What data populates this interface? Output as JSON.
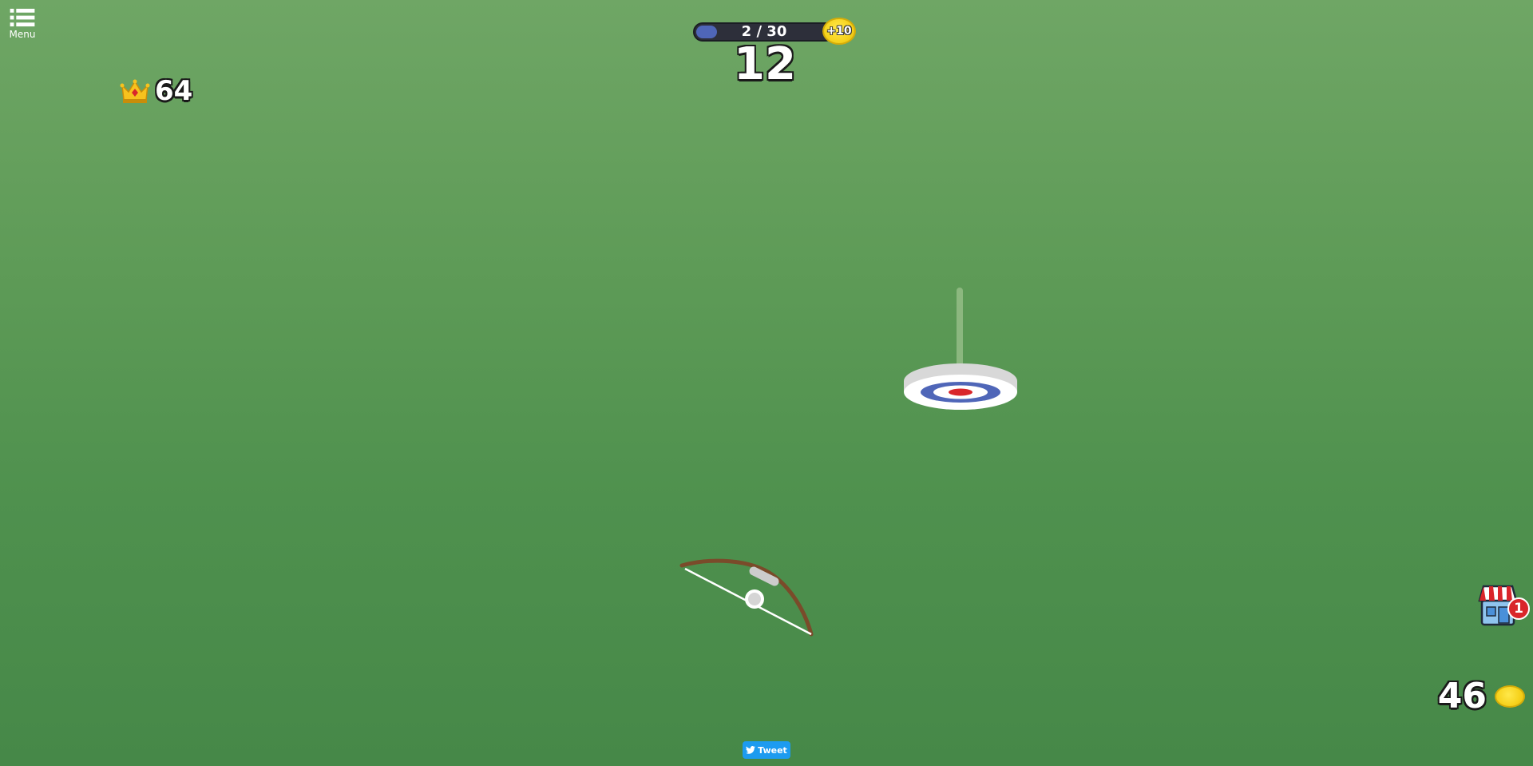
{
  "menu": {
    "label": "Menu",
    "icon": "list-icon"
  },
  "best_score": {
    "icon": "crown-icon",
    "value": "64"
  },
  "progress": {
    "text": "2 / 30",
    "fraction": 0.067,
    "reward_label": "+10",
    "fill_color": "#4f66b8"
  },
  "current_score": "12",
  "target": {
    "icon": "bullseye-target",
    "colors": {
      "outer": "#ffffff",
      "ring": "#4f66b8",
      "center": "#d9262b"
    }
  },
  "bow": {
    "icon": "bow-icon",
    "wood_color": "#7a4b2a"
  },
  "shop": {
    "icon": "shop-icon",
    "badge": "1"
  },
  "coins": {
    "value": "46",
    "icon": "coin-icon"
  },
  "tweet": {
    "label": "Tweet",
    "icon": "twitter-bird-icon"
  },
  "colors": {
    "background_top": "#6fa665",
    "background_bottom": "#468848"
  }
}
